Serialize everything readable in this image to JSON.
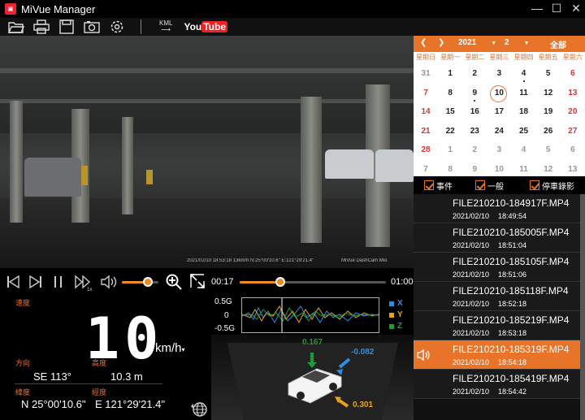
{
  "window": {
    "title": "MiVue Manager",
    "logo_text": "MiVue"
  },
  "toolbar": {
    "icons": [
      "folder-open-icon",
      "printer-icon",
      "save-icon",
      "camera-icon",
      "gear-icon"
    ],
    "kml_label": "KML",
    "youtube_label_a": "You",
    "youtube_label_b": "Tube"
  },
  "video": {
    "osd_left": "2021/02/10 18:53:18  13km/h  N:25°00'10.6\"  E:121°29'21.4\"",
    "osd_right": "MiVue DashCam  Mio"
  },
  "playback": {
    "speed_mark": "1x",
    "current_time": "00:17",
    "end_time": "01:00",
    "progress": 0.28,
    "volume": 0.72
  },
  "dashboard": {
    "speed_label": "速度",
    "speed": "10",
    "speed_unit": "km/h",
    "heading_label": "方向",
    "heading": "SE 113°",
    "altitude_label": "高度",
    "altitude": "10.3  m",
    "lat_label": "緯度",
    "lat": "N 25°00'10.6\"",
    "lon_label": "經度",
    "lon": "E 121°29'21.4\""
  },
  "gsensor": {
    "axis_top": "0.5G",
    "axis_mid": "0",
    "axis_bottom": "-0.5G",
    "legend": [
      {
        "label": "X",
        "color": "#2a8fe0"
      },
      {
        "label": "Y",
        "color": "#e8a21a"
      },
      {
        "label": "Z",
        "color": "#1f9a3a"
      }
    ],
    "g_top": "0.167",
    "g_right": "-0.082",
    "g_bottom": "0.301"
  },
  "calendar": {
    "year": "2021",
    "month": "2",
    "all_label": "全部",
    "weekdays": [
      "星期日",
      "星期一",
      "星期二",
      "星期三",
      "星期四",
      "星期五",
      "星期六"
    ],
    "weeks": [
      [
        "31",
        "1",
        "2",
        "3",
        "4",
        "5",
        "6"
      ],
      [
        "7",
        "8",
        "9",
        "10",
        "11",
        "12",
        "13"
      ],
      [
        "14",
        "15",
        "16",
        "17",
        "18",
        "19",
        "20"
      ],
      [
        "21",
        "22",
        "23",
        "24",
        "25",
        "26",
        "27"
      ],
      [
        "28",
        "1",
        "2",
        "3",
        "4",
        "5",
        "6"
      ],
      [
        "7",
        "8",
        "9",
        "10",
        "11",
        "12",
        "13"
      ]
    ]
  },
  "filters": {
    "event": "事件",
    "normal": "一般",
    "parking": "停車錄影"
  },
  "files": [
    {
      "name": "FILE210210-184917F.MP4",
      "date": "2021/02/10",
      "time": "18:49:54"
    },
    {
      "name": "FILE210210-185005F.MP4",
      "date": "2021/02/10",
      "time": "18:51:04"
    },
    {
      "name": "FILE210210-185105F.MP4",
      "date": "2021/02/10",
      "time": "18:51:06"
    },
    {
      "name": "FILE210210-185118F.MP4",
      "date": "2021/02/10",
      "time": "18:52:18"
    },
    {
      "name": "FILE210210-185219F.MP4",
      "date": "2021/02/10",
      "time": "18:53:18"
    },
    {
      "name": "FILE210210-185319F.MP4",
      "date": "2021/02/10",
      "time": "18:54:18"
    },
    {
      "name": "FILE210210-185419F.MP4",
      "date": "2021/02/10",
      "time": "18:54:42"
    }
  ]
}
